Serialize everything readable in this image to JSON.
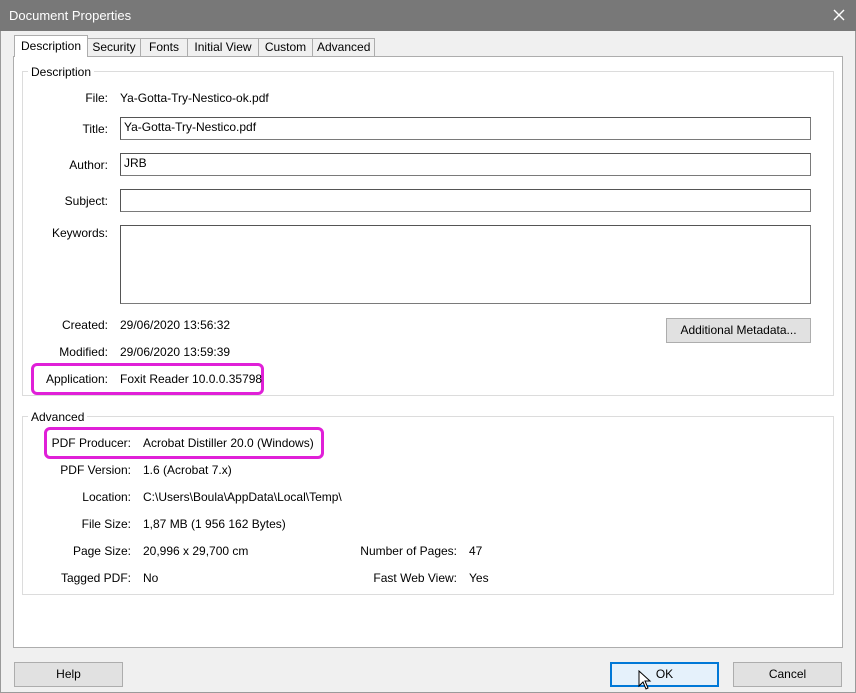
{
  "window": {
    "title": "Document Properties",
    "close_glyph": "✕"
  },
  "tabs": [
    {
      "label": "Description"
    },
    {
      "label": "Security"
    },
    {
      "label": "Fonts"
    },
    {
      "label": "Initial View"
    },
    {
      "label": "Custom"
    },
    {
      "label": "Advanced"
    }
  ],
  "description": {
    "legend": "Description",
    "file_label": "File:",
    "file_value": "Ya-Gotta-Try-Nestico-ok.pdf",
    "title_label": "Title:",
    "title_value": "Ya-Gotta-Try-Nestico.pdf",
    "author_label": "Author:",
    "author_value": "JRB",
    "subject_label": "Subject:",
    "subject_value": "",
    "keywords_label": "Keywords:",
    "keywords_value": "",
    "created_label": "Created:",
    "created_value": "29/06/2020 13:56:32",
    "modified_label": "Modified:",
    "modified_value": "29/06/2020 13:59:39",
    "application_label": "Application:",
    "application_value": "Foxit Reader 10.0.0.35798",
    "metadata_button": "Additional Metadata..."
  },
  "advanced": {
    "legend": "Advanced",
    "producer_label": "PDF Producer:",
    "producer_value": "Acrobat Distiller 20.0 (Windows)",
    "version_label": "PDF Version:",
    "version_value": "1.6 (Acrobat 7.x)",
    "location_label": "Location:",
    "location_value": "C:\\Users\\Boula\\AppData\\Local\\Temp\\",
    "filesize_label": "File Size:",
    "filesize_value": "1,87 MB (1 956 162 Bytes)",
    "pagesize_label": "Page Size:",
    "pagesize_value": "20,996 x 29,700 cm",
    "numpages_label": "Number of Pages:",
    "numpages_value": "47",
    "tagged_label": "Tagged PDF:",
    "tagged_value": "No",
    "fastweb_label": "Fast Web View:",
    "fastweb_value": "Yes"
  },
  "buttons": {
    "help": "Help",
    "ok": "OK",
    "cancel": "Cancel"
  },
  "colors": {
    "highlight": "#e020d8",
    "titlebar": "#787878",
    "focus": "#0078d7"
  }
}
